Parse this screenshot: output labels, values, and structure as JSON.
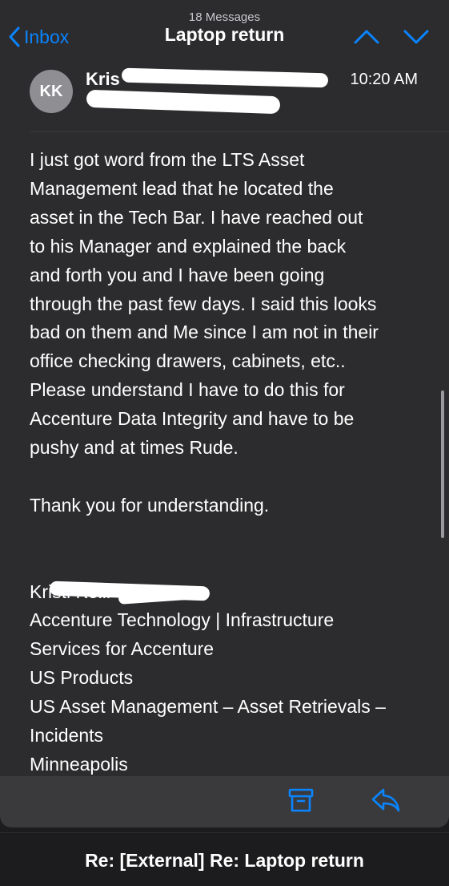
{
  "nav": {
    "message_count": "18 Messages",
    "title": "Laptop return",
    "back_label": "Inbox",
    "accent": "#0a84ff"
  },
  "header": {
    "avatar_initials": "KK",
    "sender_visible": "Kris",
    "time": "10:20 AM"
  },
  "body": {
    "lines": [
      "I just got word from the LTS Asset",
      "Management lead that he located the",
      "asset in the Tech Bar. I have reached out",
      "to his Manager and explained the back",
      "and forth you and I have been going",
      "through the past few days. I said this looks",
      "bad on them and Me since I am not in their",
      "office checking drawers, cabinets, etc..",
      "Please understand I have to do this for",
      "Accenture Data Integrity and have to be",
      "pushy and at times Rude."
    ],
    "closing": "Thank you for understanding.",
    "signature": {
      "name_visible": "Kristi Kolli",
      "lines": [
        "Accenture Technology | Infrastructure",
        "Services for Accenture",
        "US Products",
        "US Asset Management – Asset Retrievals –",
        "Incidents",
        "Minneapolis"
      ]
    }
  },
  "toolbar": {
    "icons": [
      "archive-icon",
      "reply-icon"
    ]
  },
  "bottom": {
    "title": "Re: [External] Re:  Laptop return"
  }
}
